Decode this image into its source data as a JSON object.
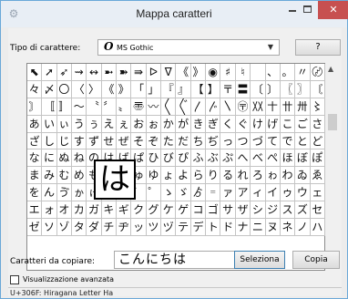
{
  "window": {
    "title": "Mappa caratteri",
    "minimize_icon": "minimize-icon",
    "maximize_icon": "maximize-icon",
    "close_icon": "close-icon",
    "close_glyph": "✕",
    "close_color": "#c75050"
  },
  "font": {
    "label": "Tipo di carattere:",
    "selected": "MS Gothic",
    "type_glyph": "O",
    "help_label": "?"
  },
  "grid": {
    "rows": [
      [
        "⬉",
        "➚",
        "➶",
        "⇝",
        "↭",
        "➼",
        "➽",
        "⇛",
        "ᐅ",
        "ᐁ",
        "《",
        "》",
        "◉",
        "♯",
        "♮",
        "",
        "、",
        "。",
        "〃",
        "〄"
      ],
      [
        "々",
        "〆",
        "〇",
        "〈",
        "〉",
        "《",
        "》",
        "「",
        "」",
        "『",
        "』",
        "【",
        "】",
        "〒",
        "〓",
        "〔",
        "〕",
        "〖",
        "〗",
        "〘"
      ],
      [
        "〙",
        "〚",
        "〛",
        "〜",
        "〝",
        "〞",
        "〟",
        "〠",
        "〰",
        "〱",
        "〲",
        "〳",
        "〴",
        "〵",
        "〶",
        "〷",
        "〸",
        "〹",
        "〺",
        "〻"
      ],
      [
        "あ",
        "い",
        "ぃ",
        "う",
        "ぅ",
        "え",
        "ぇ",
        "お",
        "ぉ",
        "か",
        "が",
        "き",
        "ぎ",
        "く",
        "ぐ",
        "け",
        "げ",
        "こ",
        "ご",
        "さ"
      ],
      [
        "ざ",
        "し",
        "じ",
        "す",
        "ず",
        "せ",
        "ぜ",
        "そ",
        "ぞ",
        "た",
        "だ",
        "ち",
        "ぢ",
        "っ",
        "つ",
        "づ",
        "て",
        "で",
        "と",
        "ど"
      ],
      [
        "な",
        "に",
        "ぬ",
        "ね",
        "の",
        "は",
        "ば",
        "ぱ",
        "ひ",
        "び",
        "ぴ",
        "ふ",
        "ぶ",
        "ぷ",
        "へ",
        "べ",
        "ぺ",
        "ほ",
        "ぼ",
        "ぽ"
      ],
      [
        "ま",
        "み",
        "む",
        "め",
        "も",
        "ゃ",
        "や",
        "ゅ",
        "ゆ",
        "ょ",
        "よ",
        "ら",
        "り",
        "る",
        "れ",
        "ろ",
        "ゎ",
        "わ",
        "ゐ",
        "ゑ"
      ],
      [
        "を",
        "ん",
        "ゔ",
        "ゕ",
        "ゖ",
        "゙",
        "゚",
        "゛",
        "゜",
        "ゝ",
        "ゞ",
        "ゟ",
        "゠",
        "ァ",
        "ア",
        "ィ",
        "イ",
        "ゥ",
        "ウ",
        "ェ"
      ],
      [
        "エ",
        "ォ",
        "オ",
        "カ",
        "ガ",
        "キ",
        "ギ",
        "ク",
        "グ",
        "ケ",
        "ゲ",
        "コ",
        "ゴ",
        "サ",
        "ザ",
        "シ",
        "ジ",
        "ス",
        "ズ",
        "セ"
      ],
      [
        "ゼ",
        "ソ",
        "ゾ",
        "タ",
        "ダ",
        "チ",
        "ヂ",
        "ッ",
        "ツ",
        "ヅ",
        "テ",
        "デ",
        "ト",
        "ド",
        "ナ",
        "ニ",
        "ヌ",
        "ネ",
        "ノ",
        "ハ"
      ]
    ],
    "selected_char": "は",
    "scroll_up_icon": "scroll-up-icon",
    "scroll_down_icon": "scroll-down-icon"
  },
  "copy": {
    "label": "Caratteri da copiare:",
    "value": "こんにちは",
    "select_label": "Seleziona",
    "copy_label": "Copia"
  },
  "advanced": {
    "label": "Visualizzazione avanzata",
    "checked": false
  },
  "status": {
    "text": "U+306F: Hiragana Letter Ha"
  }
}
